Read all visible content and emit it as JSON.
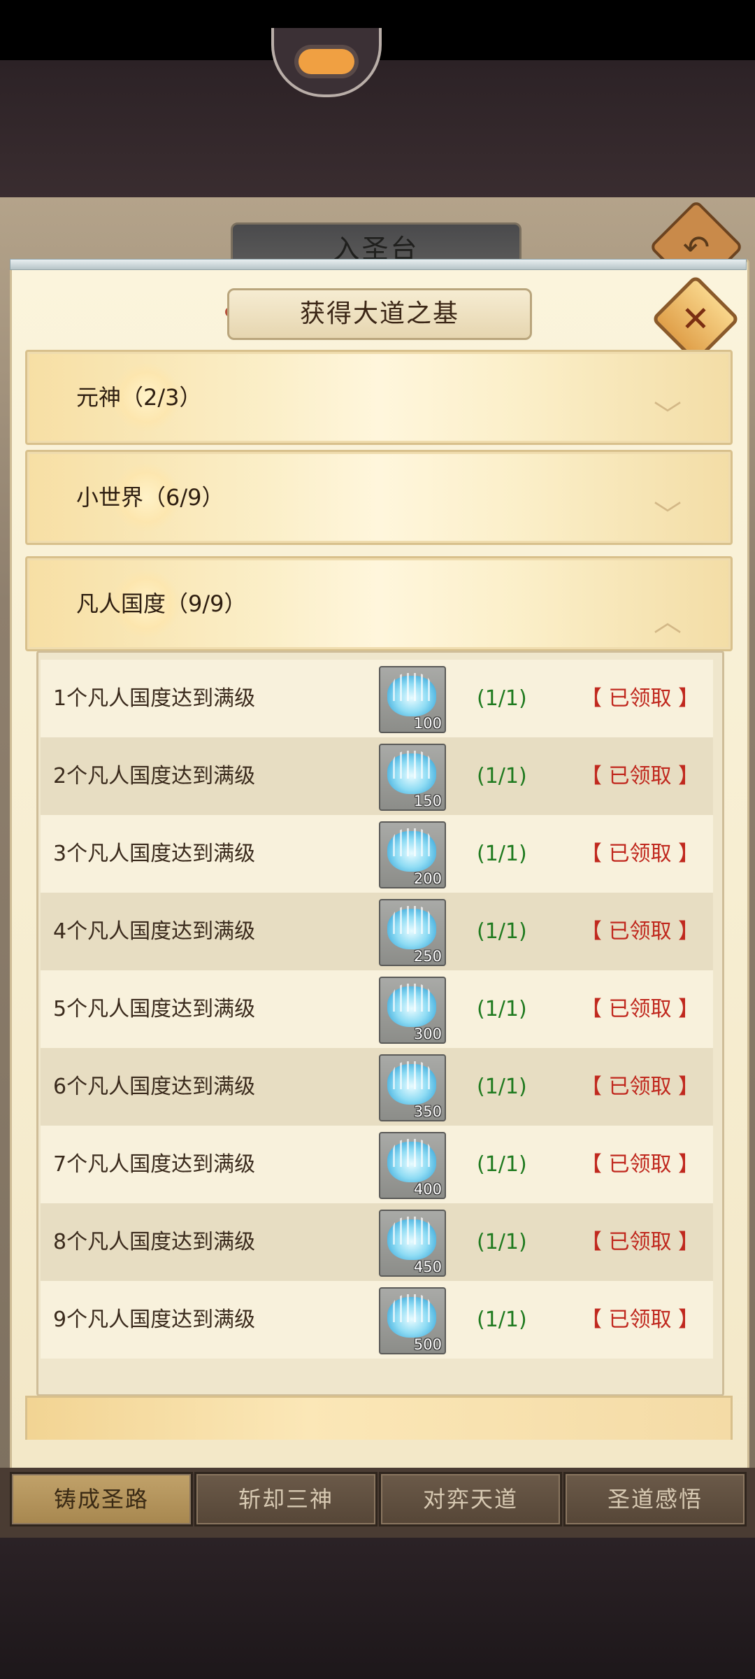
{
  "background": {
    "title": "入圣台"
  },
  "modal": {
    "title": "获得大道之基"
  },
  "categories": [
    {
      "label": "元神（2/3）",
      "expanded": false
    },
    {
      "label": "小世界（6/9）",
      "expanded": false
    },
    {
      "label": "凡人国度（9/9）",
      "expanded": true
    }
  ],
  "rows": [
    {
      "desc": "1个凡人国度达到满级",
      "qty": "100",
      "progress": "(1/1)",
      "status": "【 已领取 】"
    },
    {
      "desc": "2个凡人国度达到满级",
      "qty": "150",
      "progress": "(1/1)",
      "status": "【 已领取 】"
    },
    {
      "desc": "3个凡人国度达到满级",
      "qty": "200",
      "progress": "(1/1)",
      "status": "【 已领取 】"
    },
    {
      "desc": "4个凡人国度达到满级",
      "qty": "250",
      "progress": "(1/1)",
      "status": "【 已领取 】"
    },
    {
      "desc": "5个凡人国度达到满级",
      "qty": "300",
      "progress": "(1/1)",
      "status": "【 已领取 】"
    },
    {
      "desc": "6个凡人国度达到满级",
      "qty": "350",
      "progress": "(1/1)",
      "status": "【 已领取 】"
    },
    {
      "desc": "7个凡人国度达到满级",
      "qty": "400",
      "progress": "(1/1)",
      "status": "【 已领取 】"
    },
    {
      "desc": "8个凡人国度达到满级",
      "qty": "450",
      "progress": "(1/1)",
      "status": "【 已领取 】"
    },
    {
      "desc": "9个凡人国度达到满级",
      "qty": "500",
      "progress": "(1/1)",
      "status": "【 已领取 】"
    }
  ],
  "tabs": [
    {
      "label": "铸成圣路",
      "active": true
    },
    {
      "label": "斩却三神",
      "active": false
    },
    {
      "label": "对弈天道",
      "active": false
    },
    {
      "label": "圣道感悟",
      "active": false
    }
  ],
  "icons": {
    "close": "close-icon",
    "back": "back-arrow-icon",
    "collapsed": "chevron-down-icon",
    "expanded": "chevron-up-icon",
    "reward": "crystal-platform-icon"
  },
  "colors": {
    "progress": "#1f7a1f",
    "claimed": "#c0281e",
    "active_tab": "#b39258"
  }
}
